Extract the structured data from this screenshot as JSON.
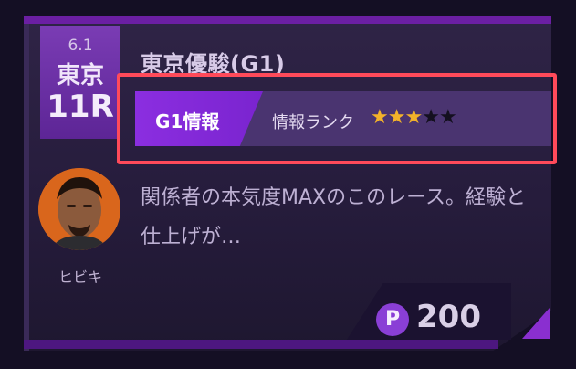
{
  "race": {
    "date": "6.1",
    "venue": "東京",
    "race_number": "11R",
    "title": "東京優駿(G1)"
  },
  "info": {
    "tag": "G1情報",
    "rank_label": "情報ランク",
    "rank": 3,
    "rank_max": 5
  },
  "author": {
    "name": "ヒビキ"
  },
  "description": "関係者の本気度MAXのこのレース。経験と仕上げが…",
  "price": {
    "icon_label": "P",
    "value": "200"
  },
  "colors": {
    "accent": "#8b2ee0",
    "highlight": "#ff4a5a",
    "star": "#f3b22a"
  }
}
